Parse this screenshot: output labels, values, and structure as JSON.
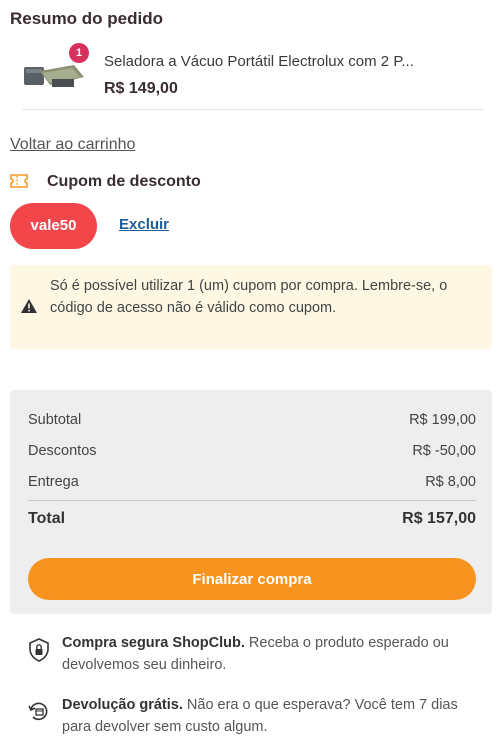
{
  "summary": {
    "title": "Resumo do pedido"
  },
  "product": {
    "qty_badge": "1",
    "name": "Seladora a Vácuo Portátil Electrolux com 2 P...",
    "price": "R$ 149,00"
  },
  "back_link": "Voltar ao carrinho",
  "coupon": {
    "title": "Cupom de desconto",
    "code": "vale50",
    "remove_label": "Excluir"
  },
  "warning": {
    "text": "Só é possível utilizar 1 (um) cupom por compra. Lembre-se, o código de acesso não é válido como cupom."
  },
  "totals": {
    "subtotal_label": "Subtotal",
    "subtotal_value": "R$ 199,00",
    "discounts_label": "Descontos",
    "discounts_value": "R$ -50,00",
    "delivery_label": "Entrega",
    "delivery_value": "R$ 8,00",
    "total_label": "Total",
    "total_value": "R$ 157,00"
  },
  "checkout_button": "Finalizar compra",
  "benefits": [
    {
      "title": "Compra segura ShopClub.",
      "text": " Receba o produto esperado ou devolvemos seu dinheiro.",
      "icon": "shield-lock-icon"
    },
    {
      "title": "Devolução grátis.",
      "text": " Não era o que esperava? Você tem 7 dias para devolver sem custo algum.",
      "icon": "return-box-icon"
    }
  ],
  "colors": {
    "coupon_pill": "#f2464b",
    "checkout": "#f7931e",
    "badge": "#d6305d",
    "warning_bg": "#fdf7e4",
    "link": "#1f5e96"
  }
}
